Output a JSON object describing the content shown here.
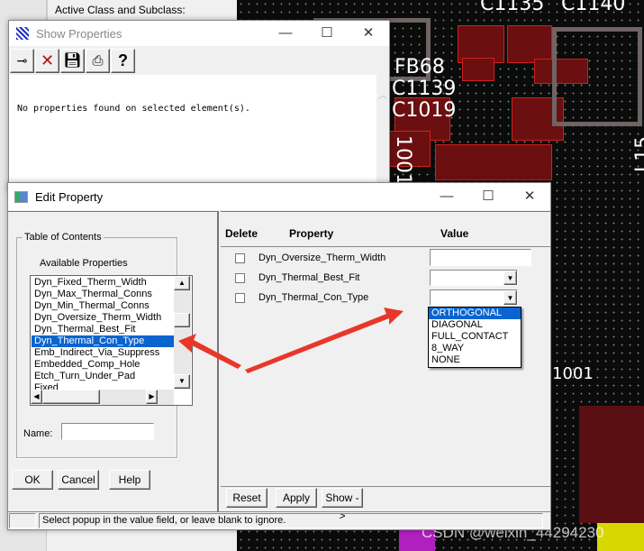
{
  "background": {
    "active_class_label": "Active Class and Subclass:",
    "pcb_labels": [
      "C1135",
      "C1140",
      "FB68",
      "C1139",
      "C1019",
      "1001",
      "L15",
      "1001"
    ],
    "watermark": "CSDN @weixin_44294230"
  },
  "show_properties": {
    "title": "Show Properties",
    "toolbar": [
      {
        "icon": "pin-icon"
      },
      {
        "icon": "close-red-x-icon"
      },
      {
        "icon": "save-disk-icon"
      },
      {
        "icon": "printer-icon"
      },
      {
        "icon": "help-question-icon"
      }
    ],
    "message": "No properties found on selected element(s)."
  },
  "edit_property": {
    "title": "Edit Property",
    "toc_label": "Table of Contents",
    "available_label": "Available Properties",
    "available_items": [
      "Dyn_Fixed_Therm_Width",
      "Dyn_Max_Thermal_Conns",
      "Dyn_Min_Thermal_Conns",
      "Dyn_Oversize_Therm_Width",
      "Dyn_Thermal_Best_Fit",
      "Dyn_Thermal_Con_Type",
      "Emb_Indirect_Via_Suppress",
      "Embedded_Comp_Hole",
      "Etch_Turn_Under_Pad",
      "Fixed"
    ],
    "selected_item": "Dyn_Thermal_Con_Type",
    "name_label": "Name:",
    "name_value": "",
    "ok": "OK",
    "cancel": "Cancel",
    "help": "Help",
    "headers": {
      "delete": "Delete",
      "property": "Property",
      "value": "Value"
    },
    "rows": [
      {
        "property": "Dyn_Oversize_Therm_Width",
        "value": "",
        "type": "text"
      },
      {
        "property": "Dyn_Thermal_Best_Fit",
        "value": "",
        "type": "dropdown"
      },
      {
        "property": "Dyn_Thermal_Con_Type",
        "value": "",
        "type": "dropdown"
      }
    ],
    "dropdown_options": [
      "ORTHOGONAL",
      "DIAGONAL",
      "FULL_CONTACT",
      "8_WAY",
      "NONE"
    ],
    "dropdown_highlighted": "ORTHOGONAL",
    "reset": "Reset",
    "apply": "Apply",
    "show": "Show ->",
    "status": "Select popup in the value field, or leave blank to ignore."
  },
  "colors": {
    "selection": "#0a64d0",
    "arrow": "#e8372a",
    "pcb_pad": "#6b0f10"
  }
}
